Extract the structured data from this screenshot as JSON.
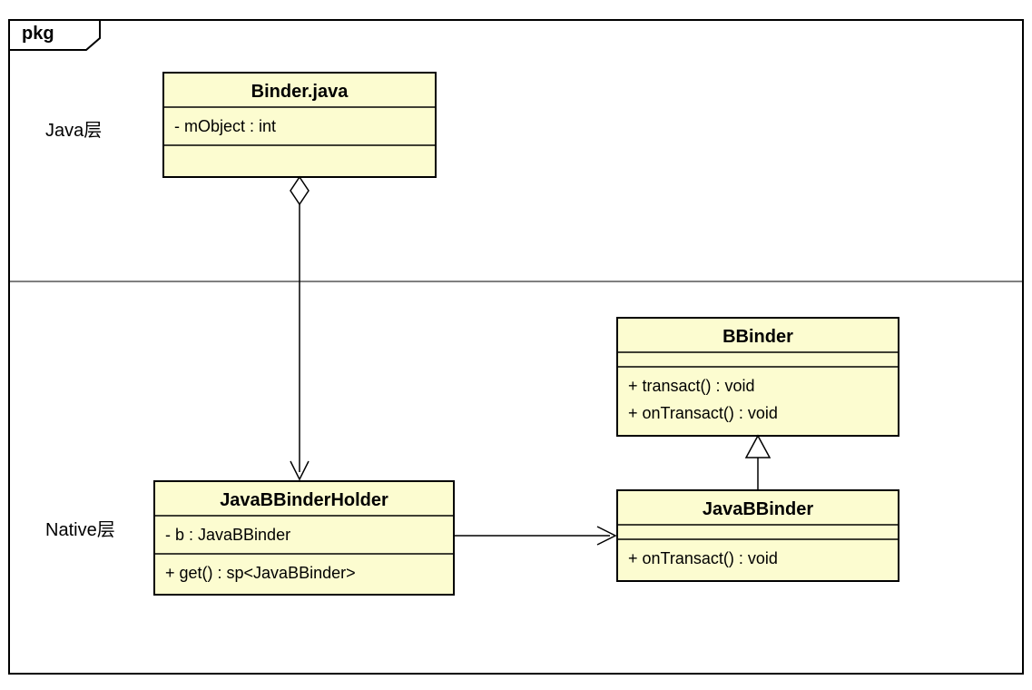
{
  "frame": {
    "label": "pkg"
  },
  "zones": {
    "java": "Java层",
    "native": "Native层"
  },
  "classes": {
    "binder": {
      "name": "Binder.java",
      "attributes": [
        "- mObject : int"
      ],
      "operations": []
    },
    "holder": {
      "name": "JavaBBinderHolder",
      "attributes": [
        "- b : JavaBBinder"
      ],
      "operations": [
        "+ get() : sp<JavaBBinder>"
      ]
    },
    "bbinder": {
      "name": "BBinder",
      "attributes": [],
      "operations": [
        "+ transact() : void",
        "+ onTransact() : void"
      ]
    },
    "javabbinder": {
      "name": "JavaBBinder",
      "attributes": [],
      "operations": [
        "+ onTransact() : void"
      ]
    }
  },
  "relations": {
    "binder_holder": {
      "type": "aggregation"
    },
    "holder_javabbinder": {
      "type": "association"
    },
    "javabbinder_bbinder": {
      "type": "generalization"
    }
  }
}
